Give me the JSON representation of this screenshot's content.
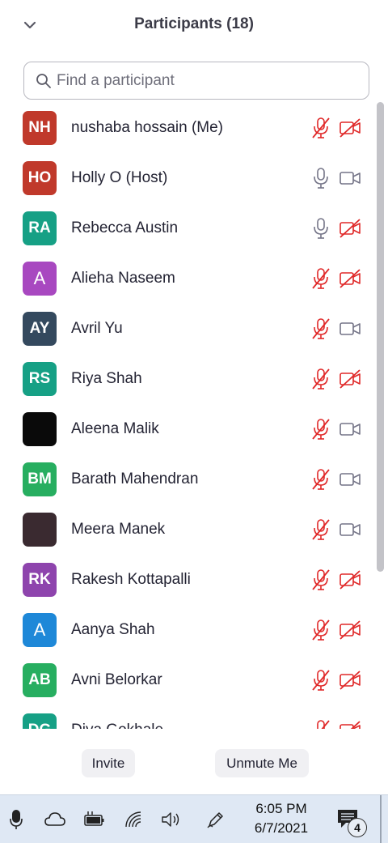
{
  "header": {
    "title": "Participants (18)"
  },
  "search": {
    "placeholder": "Find a participant"
  },
  "participants": [
    {
      "initials": "NH",
      "name": "nushaba hossain (Me)",
      "color": "#c0392b",
      "mic": "muted",
      "video": "off"
    },
    {
      "initials": "HO",
      "name": "Holly O (Host)",
      "color": "#c0392b",
      "mic": "on",
      "video": "on"
    },
    {
      "initials": "RA",
      "name": "Rebecca Austin",
      "color": "#16a085",
      "mic": "on",
      "video": "off"
    },
    {
      "initials": "A",
      "name": "Alieha Naseem",
      "color": "#a848c0",
      "mic": "muted",
      "video": "off"
    },
    {
      "initials": "AY",
      "name": "Avril Yu",
      "color": "#34495e",
      "mic": "muted",
      "video": "on"
    },
    {
      "initials": "RS",
      "name": "Riya Shah",
      "color": "#16a085",
      "mic": "muted",
      "video": "off"
    },
    {
      "initials": "",
      "name": "Aleena Malik",
      "color": "#0a0a0a",
      "mic": "muted",
      "video": "on"
    },
    {
      "initials": "BM",
      "name": "Barath Mahendran",
      "color": "#27ae60",
      "mic": "muted",
      "video": "on"
    },
    {
      "initials": "",
      "name": "Meera Manek",
      "color": "#3a2a30",
      "mic": "muted",
      "video": "on"
    },
    {
      "initials": "RK",
      "name": "Rakesh Kottapalli",
      "color": "#8e44ad",
      "mic": "muted",
      "video": "off"
    },
    {
      "initials": "A",
      "name": "Aanya Shah",
      "color": "#1e88d8",
      "mic": "muted",
      "video": "off"
    },
    {
      "initials": "AB",
      "name": "Avni Belorkar",
      "color": "#27ae60",
      "mic": "muted",
      "video": "off"
    },
    {
      "initials": "DG",
      "name": "Diya Gokhale",
      "color": "#16a085",
      "mic": "muted",
      "video": "off"
    }
  ],
  "footer": {
    "invite_label": "Invite",
    "unmute_label": "Unmute Me"
  },
  "taskbar": {
    "time": "6:05 PM",
    "date": "6/7/2021",
    "notification_count": "4",
    "icons": [
      "microphone-icon",
      "cloud-icon",
      "battery-charging-icon",
      "wifi-icon",
      "volume-icon",
      "pen-icon",
      "notification-icon"
    ]
  },
  "colors": {
    "muted_red": "#e02828",
    "icon_gray": "#747487",
    "scroll_thumb": "#c3c3c8",
    "taskbar_bg": "#dfe8f4"
  }
}
